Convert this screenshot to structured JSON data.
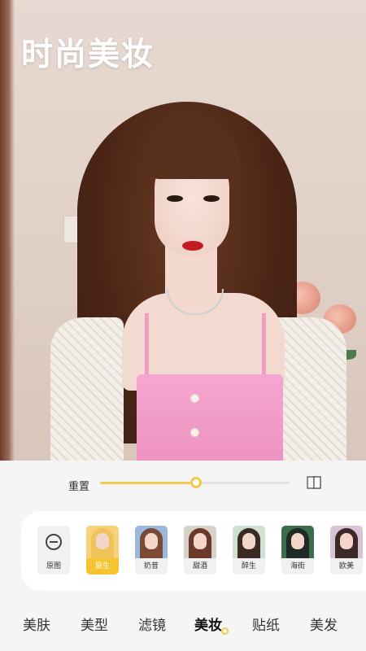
{
  "headline": "时尚美妆",
  "slider": {
    "reset_label": "重置",
    "value_fraction": 0.505
  },
  "filters": [
    {
      "label": "原图",
      "kind": "none"
    },
    {
      "label": "原生",
      "kind": "photo",
      "selected": true,
      "hair_color": "#f0c25a"
    },
    {
      "label": "奶昔",
      "kind": "photo",
      "hair_color": "#7a4a35",
      "bg": "#9bb7d9"
    },
    {
      "label": "甜酒",
      "kind": "photo",
      "hair_color": "#6b3a2a",
      "bg": "#d6d2c9"
    },
    {
      "label": "醉生",
      "kind": "photo",
      "hair_color": "#3a2a22",
      "bg": "#cfe0d2"
    },
    {
      "label": "海街",
      "kind": "photo",
      "hair_color": "#1f2a26",
      "bg": "#3e6b4c"
    },
    {
      "label": "欧美",
      "kind": "photo",
      "hair_color": "#3b2a2a",
      "bg": "#d9c3d4"
    }
  ],
  "tabs": [
    {
      "label": "美肤"
    },
    {
      "label": "美型"
    },
    {
      "label": "滤镜"
    },
    {
      "label": "美妆",
      "active": true
    },
    {
      "label": "贴纸"
    },
    {
      "label": "美发"
    }
  ],
  "colors": {
    "accent": "#f2c94c",
    "selected_label_bg": "#f6c431"
  },
  "icons": {
    "compare": "compare-icon",
    "none": "none-icon"
  }
}
